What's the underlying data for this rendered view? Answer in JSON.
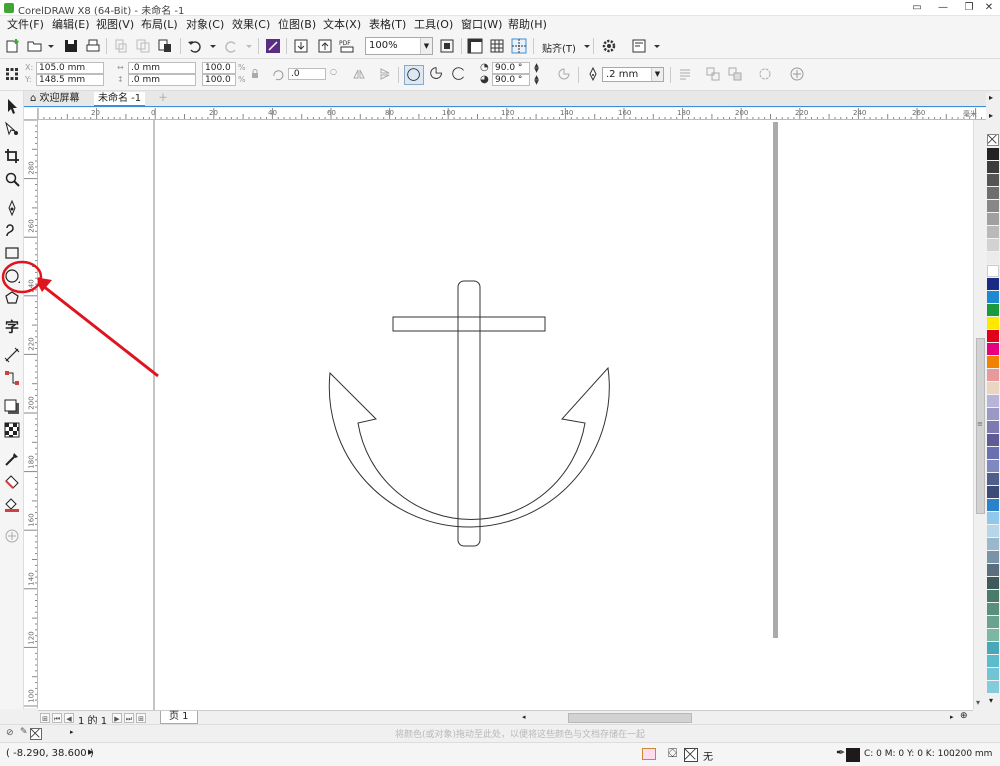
{
  "window": {
    "title": "CorelDRAW X8 (64-Bit) - 未命名 -1"
  },
  "menu": [
    "文件(F)",
    "编辑(E)",
    "视图(V)",
    "布局(L)",
    "对象(C)",
    "效果(C)",
    "位图(B)",
    "文本(X)",
    "表格(T)",
    "工具(O)",
    "窗口(W)",
    "帮助(H)"
  ],
  "std_toolbar": {
    "pdf_label": "PDF",
    "zoom": "100%",
    "snap_label": "贴齐(T)"
  },
  "property_bar": {
    "x": "105.0 mm",
    "y": "148.5 mm",
    "w": ".0 mm",
    "h": ".0 mm",
    "scale_w": "100.0",
    "scale_h": "100.0",
    "pct": "%",
    "rotation": ".0",
    "start_angle": "90.0 °",
    "end_angle": "90.0 °",
    "outline_width": ".2 mm"
  },
  "tabs": {
    "welcome": "欢迎屏幕",
    "document": "未命名 -1"
  },
  "ruler": {
    "unit": "毫米",
    "h_ticks": [
      "20",
      "0",
      "20",
      "40",
      "60",
      "80",
      "100",
      "120",
      "140",
      "160",
      "180",
      "200",
      "220",
      "240",
      "260"
    ],
    "v_ticks": [
      "280",
      "260",
      "240",
      "220",
      "200",
      "180",
      "160",
      "140",
      "120",
      "100"
    ]
  },
  "page_nav": {
    "label": "1 的 1",
    "page_tab": "页 1"
  },
  "hint": "将颜色(或对象)拖动至此处，以便将这些颜色与文档存储在一起",
  "status": {
    "coords": "( -8.290, 38.600 )",
    "fill_none": "无",
    "outline_color": "C: 0 M: 0 Y: 0 K: 100",
    "outline_width": ".200 mm"
  },
  "colors": {
    "accent": "#3b8ed6",
    "annotation": "#e0141e",
    "palette": [
      "#222222",
      "#3c3c3c",
      "#555555",
      "#6e6e6e",
      "#878787",
      "#a0a0a0",
      "#b9b9b9",
      "#d2d2d2",
      "#ebebeb",
      "#ffffff",
      "#1b2a84",
      "#1e88d0",
      "#1a9a3c",
      "#ffe800",
      "#e3001b",
      "#e6007e",
      "#f08200",
      "#e89a9a",
      "#ead5c0",
      "#b8b4d8",
      "#9a98c4",
      "#7d7ab0",
      "#5e5b96",
      "#6a6fb0",
      "#8088c0",
      "#505e8a",
      "#3c4a78",
      "#2a82c8",
      "#90c8ec",
      "#b8d4e8",
      "#9ab8cc",
      "#7894a8",
      "#5a6e7e",
      "#3e5a5a",
      "#4a7a6a",
      "#5a8e7e",
      "#6aa290",
      "#7cb6a4",
      "#48a8b8",
      "#5cbccc",
      "#70c4d4",
      "#84ccdc"
    ]
  }
}
